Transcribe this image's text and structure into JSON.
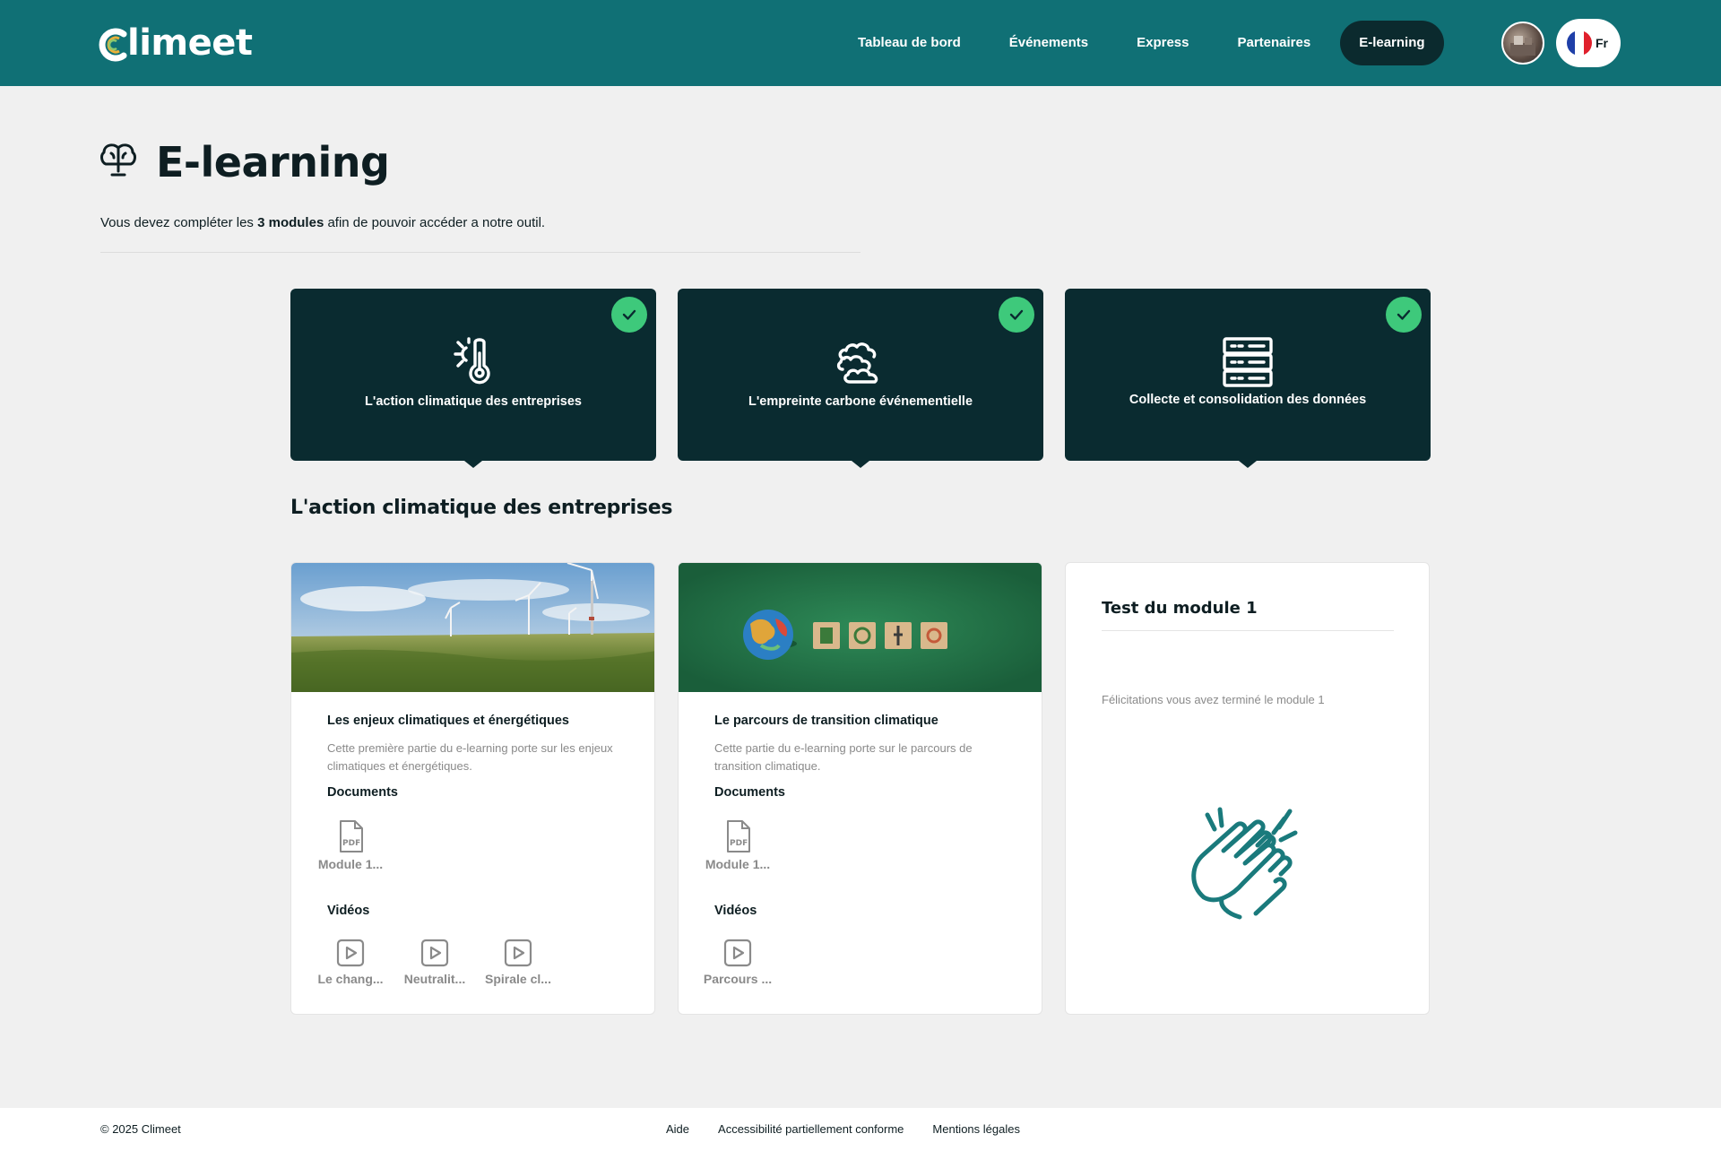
{
  "brand": {
    "name": "limeet",
    "initial": "C"
  },
  "nav": {
    "items": [
      {
        "label": "Tableau de bord"
      },
      {
        "label": "Événements"
      },
      {
        "label": "Express"
      },
      {
        "label": "Partenaires"
      },
      {
        "label": "E-learning"
      }
    ],
    "active": "E-learning"
  },
  "lang": {
    "label": "Fr"
  },
  "page": {
    "title": "E-learning",
    "intro_before": "Vous devez compléter les ",
    "intro_bold": "3 modules",
    "intro_after": " afin de pouvoir accéder a notre outil."
  },
  "modules": [
    {
      "label": "L'action climatique des entreprises",
      "icon": "thermometer-sun-icon",
      "completed": true
    },
    {
      "label": "L'empreinte carbone événementielle",
      "icon": "clouds-icon",
      "completed": true
    },
    {
      "label": "Collecte et consolidation des données",
      "icon": "database-icon",
      "completed": true
    }
  ],
  "section": {
    "title": "L'action climatique des entreprises"
  },
  "cards": [
    {
      "title": "Les enjeux climatiques et énergétiques",
      "desc": "Cette première partie du e-learning porte sur les enjeux climatiques et énergétiques.",
      "documents_label": "Documents",
      "documents": [
        "Module 1..."
      ],
      "videos_label": "Vidéos",
      "videos": [
        "Le chang...",
        "Neutralit...",
        "Spirale cl..."
      ]
    },
    {
      "title": "Le parcours de transition climatique",
      "desc": "Cette partie du e-learning porte sur le parcours de transition climatique.",
      "documents_label": "Documents",
      "documents": [
        "Module 1..."
      ],
      "videos_label": "Vidéos",
      "videos": [
        "Parcours ..."
      ]
    }
  ],
  "test": {
    "title": "Test du module 1",
    "message": "Félicitations vous avez terminé le module 1",
    "icon": "clapping-hands-icon"
  },
  "footer": {
    "copyright": "© 2025 Climeet",
    "links": [
      "Aide",
      "Accessibilité partiellement conforme",
      "Mentions légales"
    ]
  },
  "colors": {
    "header": "#107075",
    "tile": "#0a2b30",
    "check": "#3ec97b",
    "accent": "#1a7a7c"
  }
}
